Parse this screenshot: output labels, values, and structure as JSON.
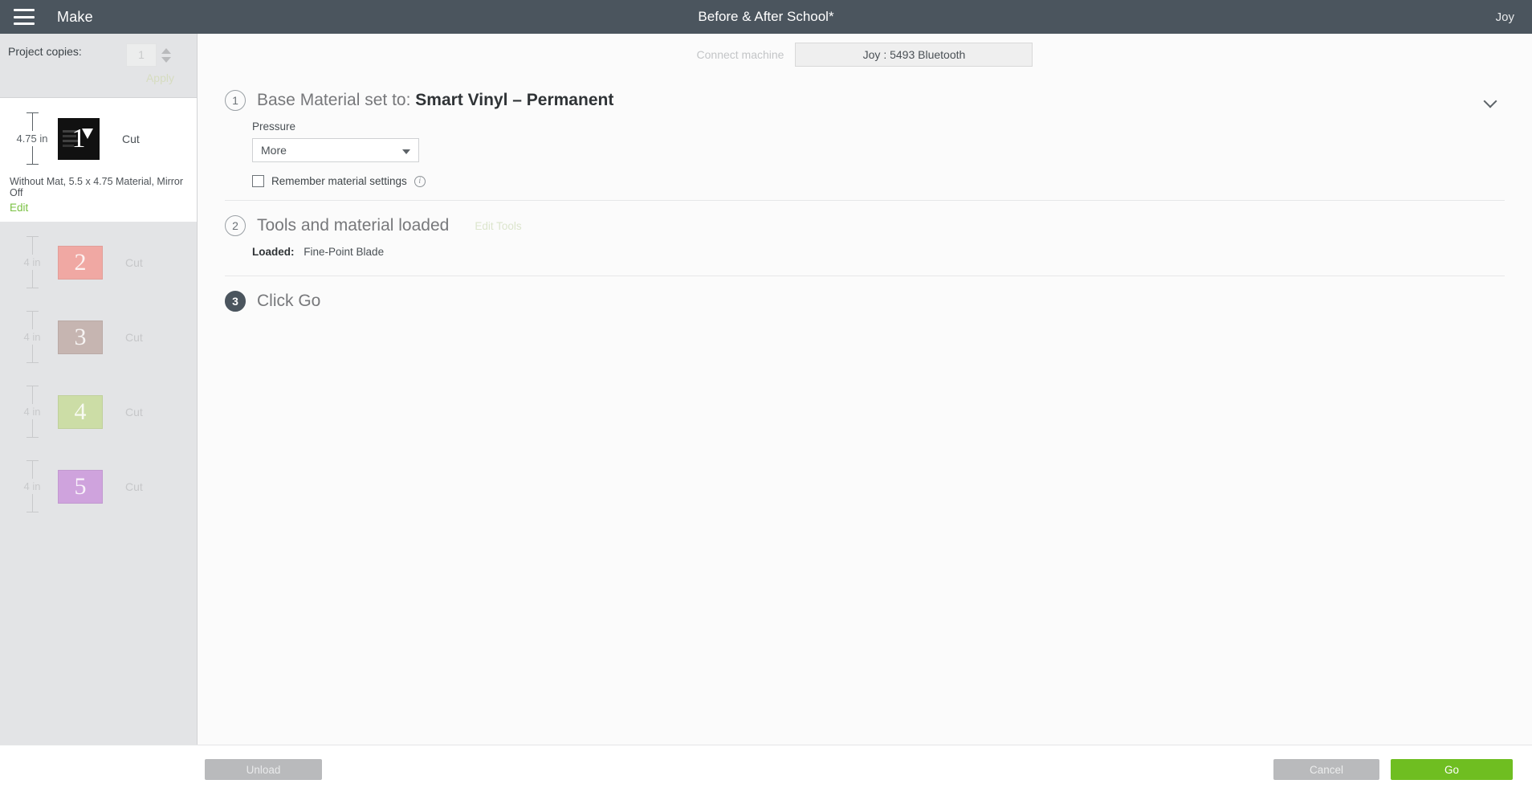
{
  "titlebar": {
    "menu_icon": "hamburger-icon",
    "mode_label": "Make",
    "project_title": "Before & After School*",
    "account_label": "Joy"
  },
  "sidebar": {
    "copies": {
      "label": "Project copies:",
      "value": "1",
      "apply_label": "Apply"
    },
    "mats": [
      {
        "dimension": "4.75 in",
        "number": "1",
        "operation": "Cut",
        "meta": "Without Mat, 5.5 x 4.75 Material, Mirror Off",
        "edit_label": "Edit",
        "color": "#111111",
        "active": true
      },
      {
        "dimension": "4 in",
        "number": "2",
        "operation": "Cut",
        "color": "#f0a8a3",
        "active": false
      },
      {
        "dimension": "4 in",
        "number": "3",
        "operation": "Cut",
        "color": "#c6b5b1",
        "active": false
      },
      {
        "dimension": "4 in",
        "number": "4",
        "operation": "Cut",
        "color": "#ccdda6",
        "active": false
      },
      {
        "dimension": "4 in",
        "number": "5",
        "operation": "Cut",
        "color": "#cfa3dd",
        "active": false
      }
    ]
  },
  "main": {
    "connect": {
      "label": "Connect machine",
      "machine": "Joy : 5493 Bluetooth"
    },
    "steps": [
      {
        "number": "1",
        "title_prefix": "Base Material set to:",
        "title_value": "Smart Vinyl – Permanent",
        "pressure_label": "Pressure",
        "pressure_value": "More",
        "remember_label": "Remember material settings"
      },
      {
        "number": "2",
        "title": "Tools and material loaded",
        "edit_tools_label": "Edit Tools",
        "loaded_label": "Loaded:",
        "loaded_value": "Fine-Point Blade"
      },
      {
        "number": "3",
        "title": "Click Go"
      }
    ]
  },
  "bottombar": {
    "unload_label": "Unload",
    "cancel_label": "Cancel",
    "go_label": "Go"
  },
  "colors": {
    "accent_green": "#6fbe21",
    "link_green": "#7ac143",
    "titlebar": "#4b555e"
  }
}
